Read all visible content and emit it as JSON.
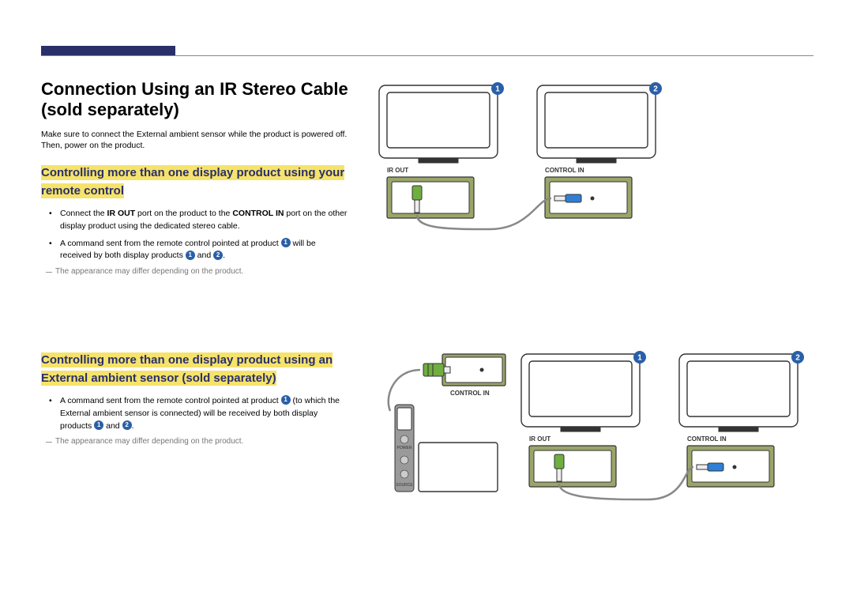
{
  "title": "Connection Using an IR Stereo Cable (sold separately)",
  "intro": "Make sure to connect the External ambient sensor while the product is powered off.  Then, power on the product.",
  "sec1": {
    "heading": "Controlling more than one display product using your remote control",
    "b1a": "Connect the ",
    "b1b": "IR OUT",
    "b1c": " port on the product to the ",
    "b1d": "CONTROL IN",
    "b1e": " port on the other display product using the dedicated stereo cable.",
    "b2a": "A command sent from the remote control pointed at product ",
    "b2b": " will be received by both display products ",
    "b2c": " and ",
    "b2d": "."
  },
  "footnote": "The appearance may differ depending on the product.",
  "sec2": {
    "heading": "Controlling more than one display product using an External ambient sensor (sold separately)",
    "b1a": "A command sent from the remote control pointed at product ",
    "b1b": " (to which the External ambient sensor is connected) will be received by both display products ",
    "b1c": " and ",
    "b1d": "."
  },
  "labels": {
    "irout": "IR OUT",
    "controlin": "CONTROL IN",
    "power": "POWER",
    "source": "SOURCE"
  },
  "nums": {
    "one": "1",
    "two": "2"
  }
}
